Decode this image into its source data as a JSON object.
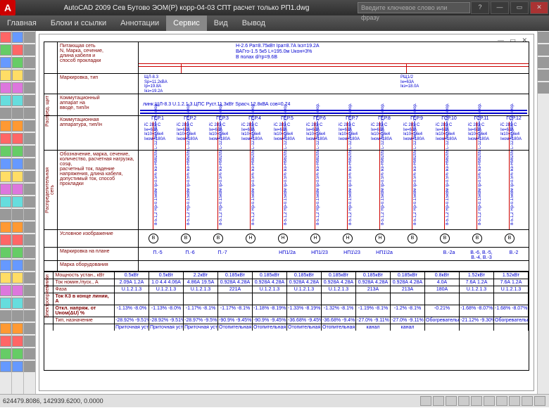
{
  "title": "AutoCAD 2009  Сев Бутово ЭОМ(Р) корр-04-03 СПТ расчет только РП1.dwg",
  "search_placeholder": "Введите ключевое слово или фразу",
  "menu": [
    "Главная",
    "Блоки и ссылки",
    "Аннотации",
    "Сервис",
    "Вид",
    "Вывод"
  ],
  "menu_active": 3,
  "header_rows": {
    "feed": "Питающая сеть\nN, Марка, сечение,\nдлина кабеля и\nспособ прокладки",
    "mark": "Маркировка, тип",
    "comm_in": "Коммутационный\nаппарат на\nвводе, тип/Iн",
    "comm_app": "Коммутационная\nаппаратура, тип/Iн",
    "dist": "Обозначение, марка, сечение,\nколичество, расчетная нагрузка, cosφ,\nрасчетный ток, падение\nнапряжения, длина кабеля,\nдопустимый ток, способ\nпрокладки",
    "symbol": "Условное изображение",
    "plan": "Маркировка на плане",
    "equip": "Марка оборудования"
  },
  "side_labels": {
    "rasp_shield": "Распред. щит",
    "dist_net": "Распределительная\nсеть",
    "receivers": "Электроприемники"
  },
  "top_note": "Н-2.6 Ра=8.75кВт Iра=8.7А Iкз=19.2А\nВАГго-1.5 5к5 L=195.0м Uкон=3%\nВ полах d/тр=9.6В",
  "top_labels": {
    "left": "ЩЛ-8.3\nSр=11.2кВA\nIр=19.8A\nIкз=19.2A",
    "right": "РЩ1/2\nIн=63А\nIкз=18.0A"
  },
  "bus_note": "линк ЩЛ-8.3  U.1.2.1.3.ЦПС  Руст.11.3кВт  Sрасч.12.8кВА  сов=0.74",
  "breakers": {
    "label": "iC 283 C\nIн=63А\nIк10=56к4\nIном=180А"
  },
  "feeder_id": [
    "ГСР.1",
    "ГСР.2",
    "ГСР.3",
    "ГСР.4",
    "ГСР.5",
    "ГСР.6",
    "ГСР.7",
    "ГСР.8",
    "ГСР.9",
    "ГСР.10",
    "ГСР.11",
    "ГСР.12"
  ],
  "cable_text": "8-5.1,2 Rp-0.15кВм\nIp-0.5% Iкз-Н98205 L-12.0м\nUкон=1% неор.",
  "symbols": [
    "В",
    "В",
    "В",
    "Н",
    "Н",
    "Н",
    "Н",
    "Н",
    "В",
    "В",
    "В",
    "В"
  ],
  "plan_marks": [
    "П.-5",
    "П.-6",
    "П.-7",
    "",
    "НП1/2а",
    "НП1/23",
    "НП1\\23",
    "НП1\\2а",
    "",
    "В.-2а",
    "В.-6, В.-5, В.-4, В.-3",
    "В.-2"
  ],
  "rows": {
    "power": {
      "lbl": "Мощность устан., кВт",
      "v": [
        "0.5кВт",
        "0.5кВт",
        "2.2кВт",
        "0.185кВт",
        "0.185кВт",
        "0.185кВт",
        "0.185кВт",
        "0.185кВт",
        "0.185кВт",
        "0.8кВт",
        "1.52кВт",
        "1.52кВт"
      ]
    },
    "current": {
      "lbl": "Ток номин./пуск., А",
      "v": [
        "2.09А 1.2А",
        "1.0 4.4 4.06А",
        "4.86А 19.5А",
        "0.928А 4.28А",
        "0.928А 4.28А",
        "0.928А 4.28А",
        "0.928А 4.28А",
        "0.928А 4.28А",
        "0.928А 4.28А",
        "4.0А",
        "7.6А 1.2А",
        "7.6А 1.2А"
      ]
    },
    "phase": {
      "lbl": "Фаза",
      "v": [
        "U.1.2.1.3",
        "U.1.2.1.3",
        "U.1.2.1.3",
        "221А",
        "U.1.2.1.3",
        "U.1.2.1.3",
        "U.1.2.1.3",
        "213А",
        "213А",
        "180А",
        "U.1.2.1.3",
        "U.1.2.1.3"
      ]
    },
    "ik3": {
      "lbl": "Ток КЗ в конце линии, А",
      "v": [
        "",
        "",
        "",
        "",
        "",
        "",
        "",
        "",
        "",
        "",
        "",
        ""
      ]
    },
    "udev": {
      "lbl": "Откл. напряж. от Uном(ΔU) %",
      "v": [
        "-1.13% -8.0%",
        "-1.13% -8.0%",
        "-1.17% -8.1%",
        "-1.17% -8.1%",
        "-1.18% -8.19%",
        "-1.33% -8.19%",
        "-1.32% -8.1%",
        "-1.19% -8.1%",
        "-1.2% -8.1%",
        "-0.21%",
        "-1.68% -8.07%",
        "-1.68% -8.07%"
      ]
    },
    "type": {
      "lbl": "Тип, назначение",
      "v": [
        "-28.92% -9.51%",
        "-28.92% -9.51%",
        "-28.97% -9.5%",
        "-90.9% -9.45%",
        "-90.9% -9.45%",
        "-36.68% -9.45%",
        "-36.68% -9.4%",
        "-27.0% -9.11%",
        "-27.0% -9.11%",
        "Обогревательные безпотолочн.",
        "-21.12% -9.30%",
        "Обогревательные безпотолочн."
      ]
    },
    "purpose": {
      "lbl": "",
      "v": [
        "Приточная установка",
        "Приточная установка",
        "Приточная установка",
        "Отопительная установка",
        "Отопительная установка",
        "Отопительная установка",
        "Отопительная",
        "канал",
        "канал",
        "",
        "",
        ""
      ]
    }
  },
  "status_coords": "624479.8086, 142939.6200, 0.0000"
}
